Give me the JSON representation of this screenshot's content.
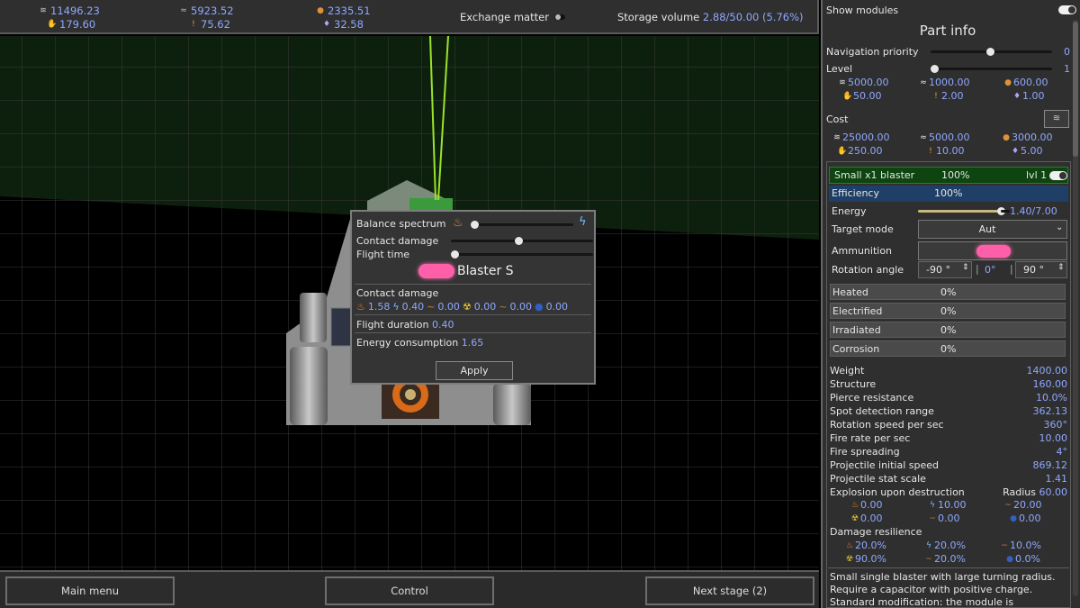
{
  "topbar": {
    "resources": [
      {
        "icon": "metal-icon",
        "value": "11496.23"
      },
      {
        "icon": "crystal-icon",
        "value": "5923.52"
      },
      {
        "icon": "ore-icon",
        "value": "2335.51"
      },
      {
        "icon": "hand-icon",
        "value": "179.60"
      },
      {
        "icon": "heat-icon",
        "value": "75.62"
      },
      {
        "icon": "energy-icon",
        "value": "32.58"
      }
    ],
    "exchange_label": "Exchange matter",
    "storage_label": "Storage volume",
    "storage_value": "2.88/50.00 (5.76%)"
  },
  "bottom": {
    "main_menu": "Main menu",
    "control": "Control",
    "next_stage": "Next stage (2)"
  },
  "popup": {
    "balance_label": "Balance spectrum",
    "contact_damage_label": "Contact damage",
    "flight_time_label": "Flight time",
    "projectile_name": "Blaster S",
    "section_contact": "Contact damage",
    "damage": [
      {
        "icon": "fire-icon",
        "value": "1.58"
      },
      {
        "icon": "lightning-icon",
        "value": "0.40"
      },
      {
        "icon": "wave-icon",
        "value": "0.00"
      },
      {
        "icon": "radiation-icon",
        "value": "0.00"
      },
      {
        "icon": "corrosion-icon",
        "value": "0.00"
      },
      {
        "icon": "void-icon",
        "value": "0.00"
      }
    ],
    "flight_duration_label": "Flight duration",
    "flight_duration_value": "0.40",
    "energy_consumption_label": "Energy consumption",
    "energy_consumption_value": "1.65",
    "apply": "Apply"
  },
  "panel": {
    "show_modules": "Show modules",
    "title": "Part info",
    "nav_priority": "Navigation priority",
    "nav_priority_value": "0",
    "level_label": "Level",
    "level_value": "1",
    "level_res": [
      "5000.00",
      "1000.00",
      "600.00",
      "50.00",
      "2.00",
      "1.00"
    ],
    "cost_label": "Cost",
    "cost_res": [
      "25000.00",
      "5000.00",
      "3000.00",
      "250.00",
      "10.00",
      "5.00"
    ],
    "module_name": "Small x1 blaster",
    "module_pct": "100%",
    "module_lvl": "lvl 1",
    "efficiency_label": "Efficiency",
    "efficiency_value": "100%",
    "energy_label": "Energy",
    "energy_value": "1.40/7.00",
    "target_mode_label": "Target mode",
    "target_mode_value": "Aut",
    "ammunition_label": "Ammunition",
    "rotation_label": "Rotation angle",
    "rotation_min": "-90 °",
    "rotation_mid": "0°",
    "rotation_max": "90 °",
    "effects": [
      {
        "label": "Heated",
        "value": "0%"
      },
      {
        "label": "Electrified",
        "value": "0%"
      },
      {
        "label": "Irradiated",
        "value": "0%"
      },
      {
        "label": "Corrosion",
        "value": "0%"
      }
    ],
    "stats": [
      {
        "label": "Weight",
        "value": "1400.00"
      },
      {
        "label": "Structure",
        "value": "160.00"
      },
      {
        "label": "Pierce resistance",
        "value": "10.0%"
      },
      {
        "label": "Spot detection range",
        "value": "362.13"
      },
      {
        "label": "Rotation speed per sec",
        "value": "360°"
      },
      {
        "label": "Fire rate per sec",
        "value": "10.00"
      },
      {
        "label": "Fire spreading",
        "value": "4°"
      },
      {
        "label": "Projectile initial speed",
        "value": "869.12"
      },
      {
        "label": "Projectile stat scale",
        "value": "1.41"
      }
    ],
    "explosion_label": "Explosion upon destruction",
    "radius_label": "Radius",
    "radius_value": "60.00",
    "explosion": [
      "0.00",
      "10.00",
      "20.00",
      "0.00",
      "0.00",
      "0.00"
    ],
    "resilience_label": "Damage resilience",
    "resilience": [
      "20.0%",
      "20.0%",
      "10.0%",
      "90.0%",
      "20.0%",
      "0.0%"
    ],
    "description_1": "Small single blaster with large turning radius.",
    "description_2": "Require a capacitor with positive charge.",
    "description_3": "Standard modification: the module is"
  },
  "colors": {
    "value_blue": "#8fa8ff",
    "laser_green": "#9be32a",
    "projectile_pink": "#ff5fa8",
    "selected_blue": "#1f3f66",
    "module_green": "#0e4410"
  }
}
